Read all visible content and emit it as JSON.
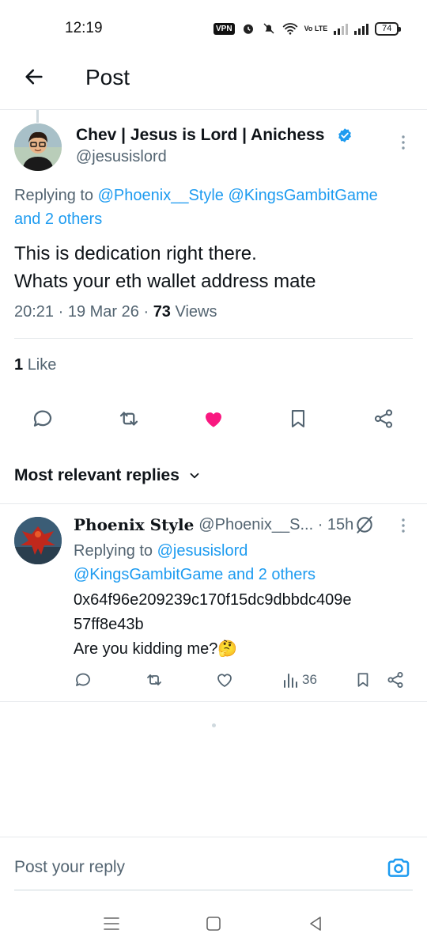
{
  "status_bar": {
    "time": "12:19",
    "vpn": "VPN",
    "volte": "Vo LTE",
    "battery": "74"
  },
  "header": {
    "title": "Post",
    "back_icon": "arrow-left-icon"
  },
  "post": {
    "author_name": "Chev | Jesus is Lord | Anichess",
    "author_handle": "@jesusislord",
    "replying_prefix": "Replying to ",
    "replying_mention_1": "@Phoenix__Style",
    "replying_mention_2": "@KingsGambitGame",
    "replying_others": "and 2 others",
    "text_line_1": "This is dedication right there.",
    "text_line_2": "Whats your eth wallet address mate",
    "time": "20:21",
    "date": "19 Mar 26",
    "views_count": "73",
    "views_label": "Views",
    "likes_count": "1",
    "likes_label": "Like",
    "liked": true
  },
  "replies_sort": {
    "label": "Most relevant replies"
  },
  "reply": {
    "name": "Phoenix Style",
    "handle": "@Phoenix__S...",
    "time": "15h",
    "replying_prefix": "Replying to ",
    "replying_mention_1": "@jesusislord",
    "replying_mention_2": "@KingsGambitGame",
    "replying_others": "and 2 others",
    "text_line_1": "0x64f96e209239c170f15dc9dbbdc409e",
    "text_line_2": "57ff8e43b",
    "text_line_3": "Are you kidding me?🤔",
    "views_count": "36"
  },
  "compose": {
    "placeholder": "Post your reply"
  },
  "colors": {
    "accent": "#1d9bf0",
    "like": "#f91880",
    "text": "#0f1419",
    "secondary": "#536471"
  }
}
